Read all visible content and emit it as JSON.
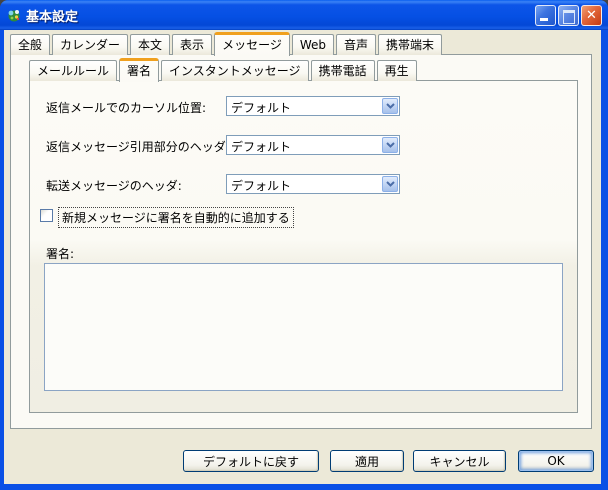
{
  "window": {
    "title": "基本設定"
  },
  "primary_tabs": [
    {
      "label": "全般",
      "active": false
    },
    {
      "label": "カレンダー",
      "active": false
    },
    {
      "label": "本文",
      "active": false
    },
    {
      "label": "表示",
      "active": false
    },
    {
      "label": "メッセージ",
      "active": true
    },
    {
      "label": "Web",
      "active": false
    },
    {
      "label": "音声",
      "active": false
    },
    {
      "label": "携帯端末",
      "active": false
    }
  ],
  "secondary_tabs": [
    {
      "label": "メールルール",
      "active": false
    },
    {
      "label": "署名",
      "active": true
    },
    {
      "label": "インスタントメッセージ",
      "active": false
    },
    {
      "label": "携帯電話",
      "active": false
    },
    {
      "label": "再生",
      "active": false
    }
  ],
  "form": {
    "reply_cursor_position": {
      "label": "返信メールでのカーソル位置:",
      "value": "デフォルト"
    },
    "reply_quote_header": {
      "label": "返信メッセージ引用部分のヘッダ:",
      "value": "デフォルト"
    },
    "forward_header": {
      "label": "転送メッセージのヘッダ:",
      "value": "デフォルト"
    },
    "auto_signature_checkbox": {
      "label": "新規メッセージに署名を自動的に追加する",
      "checked": false
    },
    "signature": {
      "label": "署名:",
      "value": ""
    }
  },
  "footer_buttons": {
    "restore_defaults": "デフォルトに戻す",
    "apply": "適用",
    "cancel": "キャンセル",
    "ok": "OK"
  },
  "colors": {
    "titlebar_blue": "#0650e4",
    "frame_blue": "#0a50e6",
    "dialog_bg": "#ece9d8",
    "panel_bg_top": "#fcfbf6",
    "panel_bg_bottom": "#f0eee3",
    "active_tab_stripe": "#f0a01e",
    "tab_border": "#919b9c",
    "field_border": "#7f9db9",
    "button_border": "#003c74",
    "close_button_red": "#c43a12"
  }
}
